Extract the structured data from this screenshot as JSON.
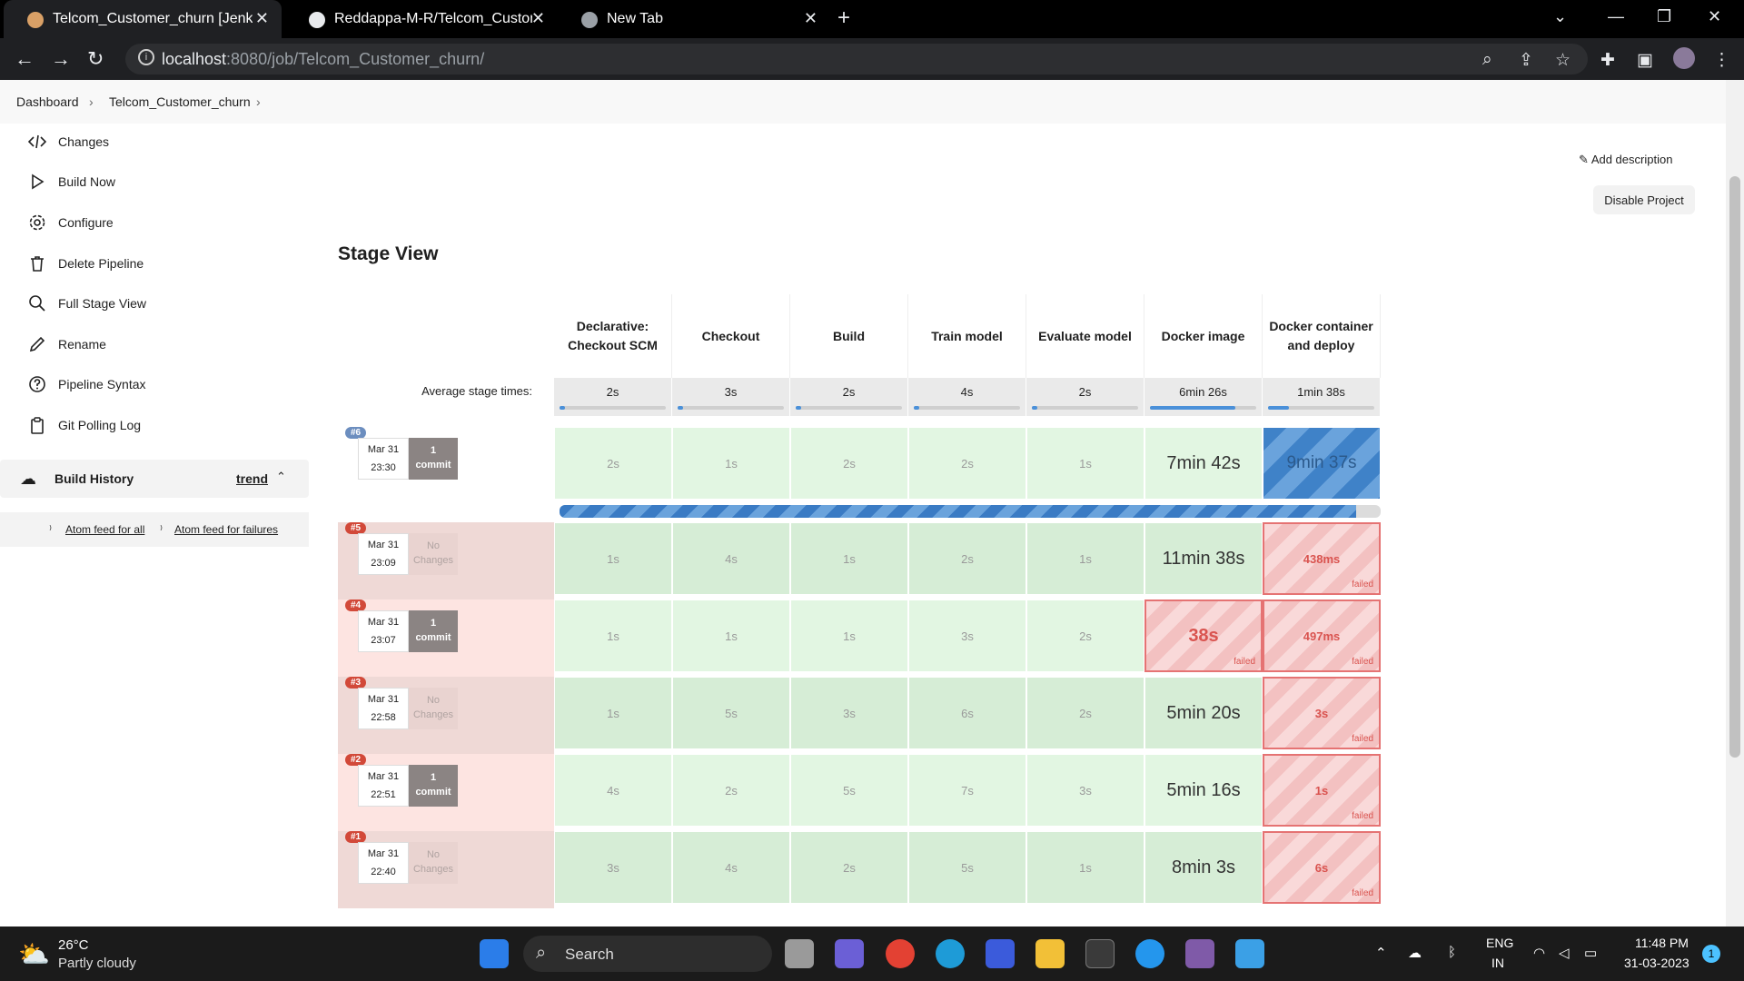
{
  "browser": {
    "tabs": [
      {
        "title": "Telcom_Customer_churn [Jenkins]",
        "active": true
      },
      {
        "title": "Reddappa-M-R/Telcom_Customer_churn",
        "active": false
      },
      {
        "title": "New Tab",
        "active": false
      }
    ],
    "url_host": "localhost",
    "url_path": ":8080/job/Telcom_Customer_churn/"
  },
  "breadcrumb": [
    "Dashboard",
    "Telcom_Customer_churn"
  ],
  "sidebar": {
    "items": [
      {
        "label": "Changes",
        "icon": "code-icon"
      },
      {
        "label": "Build Now",
        "icon": "play-icon"
      },
      {
        "label": "Configure",
        "icon": "gear-icon"
      },
      {
        "label": "Delete Pipeline",
        "icon": "trash-icon"
      },
      {
        "label": "Full Stage View",
        "icon": "search-icon"
      },
      {
        "label": "Rename",
        "icon": "pencil-icon"
      },
      {
        "label": "Pipeline Syntax",
        "icon": "help-icon"
      },
      {
        "label": "Git Polling Log",
        "icon": "clipboard-icon"
      }
    ],
    "build_history": {
      "title": "Build History",
      "trend": "trend"
    },
    "atom_all": "Atom feed for all",
    "atom_failures": "Atom feed for failures"
  },
  "actions": {
    "add_description": "Add description",
    "disable_project": "Disable Project"
  },
  "stage_view": {
    "title": "Stage View",
    "avg_label": "Average stage times:",
    "stages": [
      {
        "name": "Declarative: Checkout SCM",
        "avg": "2s",
        "avg_fill": 0.05
      },
      {
        "name": "Checkout",
        "avg": "3s",
        "avg_fill": 0.05
      },
      {
        "name": "Build",
        "avg": "2s",
        "avg_fill": 0.05
      },
      {
        "name": "Train model",
        "avg": "4s",
        "avg_fill": 0.05
      },
      {
        "name": "Evaluate model",
        "avg": "2s",
        "avg_fill": 0.05
      },
      {
        "name": "Docker image",
        "avg": "6min 26s",
        "avg_fill": 0.8
      },
      {
        "name": "Docker container and deploy",
        "avg": "1min 38s",
        "avg_fill": 0.2
      }
    ],
    "builds": [
      {
        "num": "#6",
        "date": "Mar 31",
        "time": "23:30",
        "changes": [
          "1",
          "commit"
        ],
        "status": "running",
        "cells": [
          "2s",
          "1s",
          "2s",
          "2s",
          "1s",
          "7min 42s",
          "9min 37s"
        ],
        "progress": 0.97
      },
      {
        "num": "#5",
        "date": "Mar 31",
        "time": "23:09",
        "changes": [
          "No",
          "Changes"
        ],
        "status": "failed",
        "cells": [
          "1s",
          "4s",
          "1s",
          "2s",
          "1s",
          "11min 38s",
          "438ms"
        ]
      },
      {
        "num": "#4",
        "date": "Mar 31",
        "time": "23:07",
        "changes": [
          "1",
          "commit"
        ],
        "status": "failed",
        "cells": [
          "1s",
          "1s",
          "1s",
          "3s",
          "2s",
          "38s",
          "497ms"
        ]
      },
      {
        "num": "#3",
        "date": "Mar 31",
        "time": "22:58",
        "changes": [
          "No",
          "Changes"
        ],
        "status": "failed",
        "cells": [
          "1s",
          "5s",
          "3s",
          "6s",
          "2s",
          "5min 20s",
          "3s"
        ]
      },
      {
        "num": "#2",
        "date": "Mar 31",
        "time": "22:51",
        "changes": [
          "1",
          "commit"
        ],
        "status": "failed",
        "cells": [
          "4s",
          "2s",
          "5s",
          "7s",
          "3s",
          "5min 16s",
          "1s"
        ]
      },
      {
        "num": "#1",
        "date": "Mar 31",
        "time": "22:40",
        "changes": [
          "No",
          "Changes"
        ],
        "status": "failed",
        "cells": [
          "3s",
          "4s",
          "2s",
          "5s",
          "1s",
          "8min 3s",
          "6s"
        ]
      }
    ],
    "failed_label": "failed"
  },
  "taskbar": {
    "weather_temp": "26°C",
    "weather_desc": "Partly cloudy",
    "search": "Search",
    "lang": "ENG",
    "region": "IN",
    "time": "11:48 PM",
    "date": "31-03-2023",
    "notifications": "1"
  }
}
